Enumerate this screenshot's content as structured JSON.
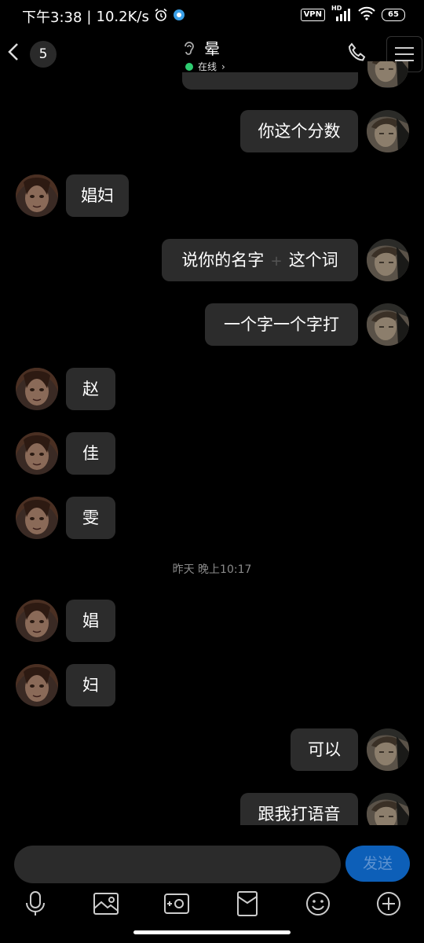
{
  "status_bar": {
    "time": "下午3:38",
    "separator": "|",
    "net_speed": "10.2K/s",
    "vpn": "VPN",
    "hd": "HD",
    "battery": "65"
  },
  "header": {
    "unread_count": "5",
    "contact_name": "晕",
    "online_status": "在线",
    "online_arrow": "›"
  },
  "messages": [
    {
      "side": "right",
      "text": "你这个分数"
    },
    {
      "side": "left",
      "text": "娼妇"
    },
    {
      "side": "right",
      "text": "说你的名字",
      "text_after": "这个词"
    },
    {
      "side": "right",
      "text": "一个字一个字打"
    },
    {
      "side": "left",
      "text": "赵"
    },
    {
      "side": "left",
      "text": "佳"
    },
    {
      "side": "left",
      "text": "雯"
    },
    {
      "side": "left",
      "text": "娼"
    },
    {
      "side": "left",
      "text": "妇"
    },
    {
      "side": "right",
      "text": "可以"
    },
    {
      "side": "right",
      "text": "跟我打语音"
    }
  ],
  "timestamp": "昨天 晚上10:17",
  "input": {
    "send_label": "发送"
  },
  "toolbar": {
    "icons": [
      "microphone-icon",
      "image-icon",
      "camera-icon",
      "red-packet-icon",
      "emoji-icon",
      "plus-icon"
    ]
  },
  "colors": {
    "background": "#000000",
    "bubble": "#2c2c2c",
    "send_button": "#0d5fb8",
    "online_dot": "#2ecc71"
  }
}
